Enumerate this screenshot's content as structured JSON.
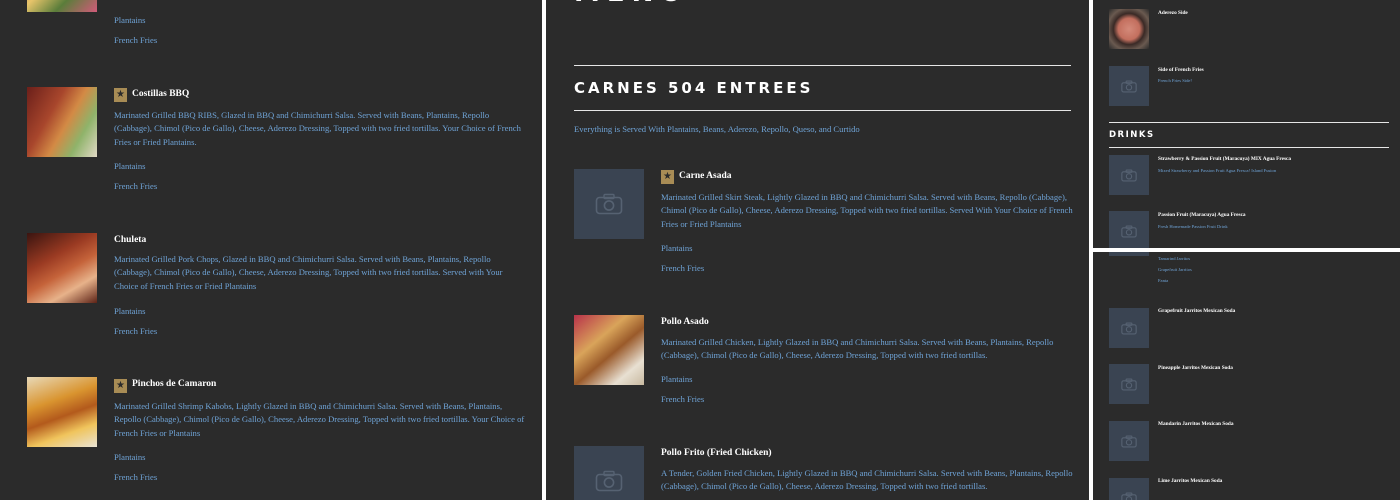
{
  "left_panel": {
    "items": [
      {
        "name": "",
        "desc": "",
        "options": [
          "Plantains",
          "French Fries"
        ]
      },
      {
        "name": "Costillas BBQ",
        "desc": "Marinated Grilled BBQ RIBS, Glazed in BBQ and Chimichurri Salsa. Served with Beans, Plantains, Repollo (Cabbage), Chimol (Pico de Gallo), Cheese, Aderezo Dressing, Topped with two fried tortillas. Your Choice of French Fries or Fried Plantains.",
        "options": [
          "Plantains",
          "French Fries"
        ]
      },
      {
        "name": "Chuleta",
        "desc": "Marinated Grilled Pork Chops, Glazed in BBQ and Chimichurri Salsa. Served with Beans, Plantains, Repollo (Cabbage), Chimol (Pico de Gallo), Cheese, Aderezo Dressing, Topped with two fried tortillas. Served with Your Choice of French Fries or Fried Plantains",
        "options": [
          "Plantains",
          "French Fries"
        ]
      },
      {
        "name": "Pinchos de Camaron",
        "desc": "Marinated Grilled Shrimp Kabobs, Lightly Glazed in BBQ and Chimichurri Salsa. Served with Beans, Plantains, Repollo (Cabbage), Chimol (Pico de Gallo), Cheese, Aderezo Dressing, Topped with two fried tortillas. Your Choice of French Fries or Plantains",
        "options": [
          "Plantains",
          "French Fries"
        ]
      }
    ]
  },
  "middle_panel": {
    "menu_title": "MENU",
    "section_title": "CARNES 504 ENTREES",
    "section_note": "Everything is Served With Plantains, Beans, Aderezo, Repollo, Queso, and Curtido",
    "items": [
      {
        "name": "Carne Asada",
        "desc": "Marinated Grilled Skirt Steak, Lightly Glazed in BBQ and Chimichurri Salsa. Served with Beans, Repollo (Cabbage), Chimol (Pico de Gallo), Cheese, Aderezo Dressing, Topped with two fried tortillas. Served With Your Choice of French Fries or Fried Plantains",
        "options": [
          "Plantains",
          "French Fries"
        ]
      },
      {
        "name": "Pollo Asado",
        "desc": "Marinated Grilled Chicken, Lightly Glazed in BBQ and Chimichurri Salsa. Served with Beans, Plantains, Repollo (Cabbage), Chimol (Pico de Gallo), Cheese, Aderezo Dressing, Topped with two fried tortillas.",
        "options": [
          "Plantains",
          "French Fries"
        ]
      },
      {
        "name": "Pollo Frito (Fried Chicken)",
        "desc": "A Tender, Golden Fried Chicken, Lightly Glazed in BBQ and Chimichurri Salsa. Served with Beans, Plantains, Repollo (Cabbage), Chimol (Pico de Gallo), Cheese, Aderezo Dressing, Topped with two fried tortillas.",
        "options": []
      }
    ]
  },
  "right_top": {
    "items": [
      {
        "name": "Aderezo Side",
        "desc": ""
      },
      {
        "name": "Side of French Fries",
        "desc": "French Fries Side!"
      }
    ],
    "drinks_title": "DRINKS",
    "drinks": [
      {
        "name": "Strawberry & Passion Fruit (Maracuya) MIX Agua Fresca",
        "desc": "Mixed Strawberry and Passion Fruit Agua Fresca! Island Fusion"
      },
      {
        "name": "Passion Fruit (Maracuya) Agua Fresca",
        "desc": "Fresh Homemade Passion Fruit Drink"
      }
    ]
  },
  "right_bottom": {
    "options": [
      "Tamarind Jarritos",
      "Grapefruit Jarritos",
      "Fanta"
    ],
    "items": [
      {
        "name": "Grapefruit Jarritos Mexican Soda"
      },
      {
        "name": "Pineapple Jarritos Mexican Soda"
      },
      {
        "name": "Mandarin Jarritos Mexican Soda"
      },
      {
        "name": "Lime Jarritos Mexican Soda"
      }
    ]
  },
  "colors": {
    "background": "#2b2b2b",
    "accent": "#6fa3d6",
    "badge": "#a88c55",
    "placeholder": "#3a4452"
  }
}
